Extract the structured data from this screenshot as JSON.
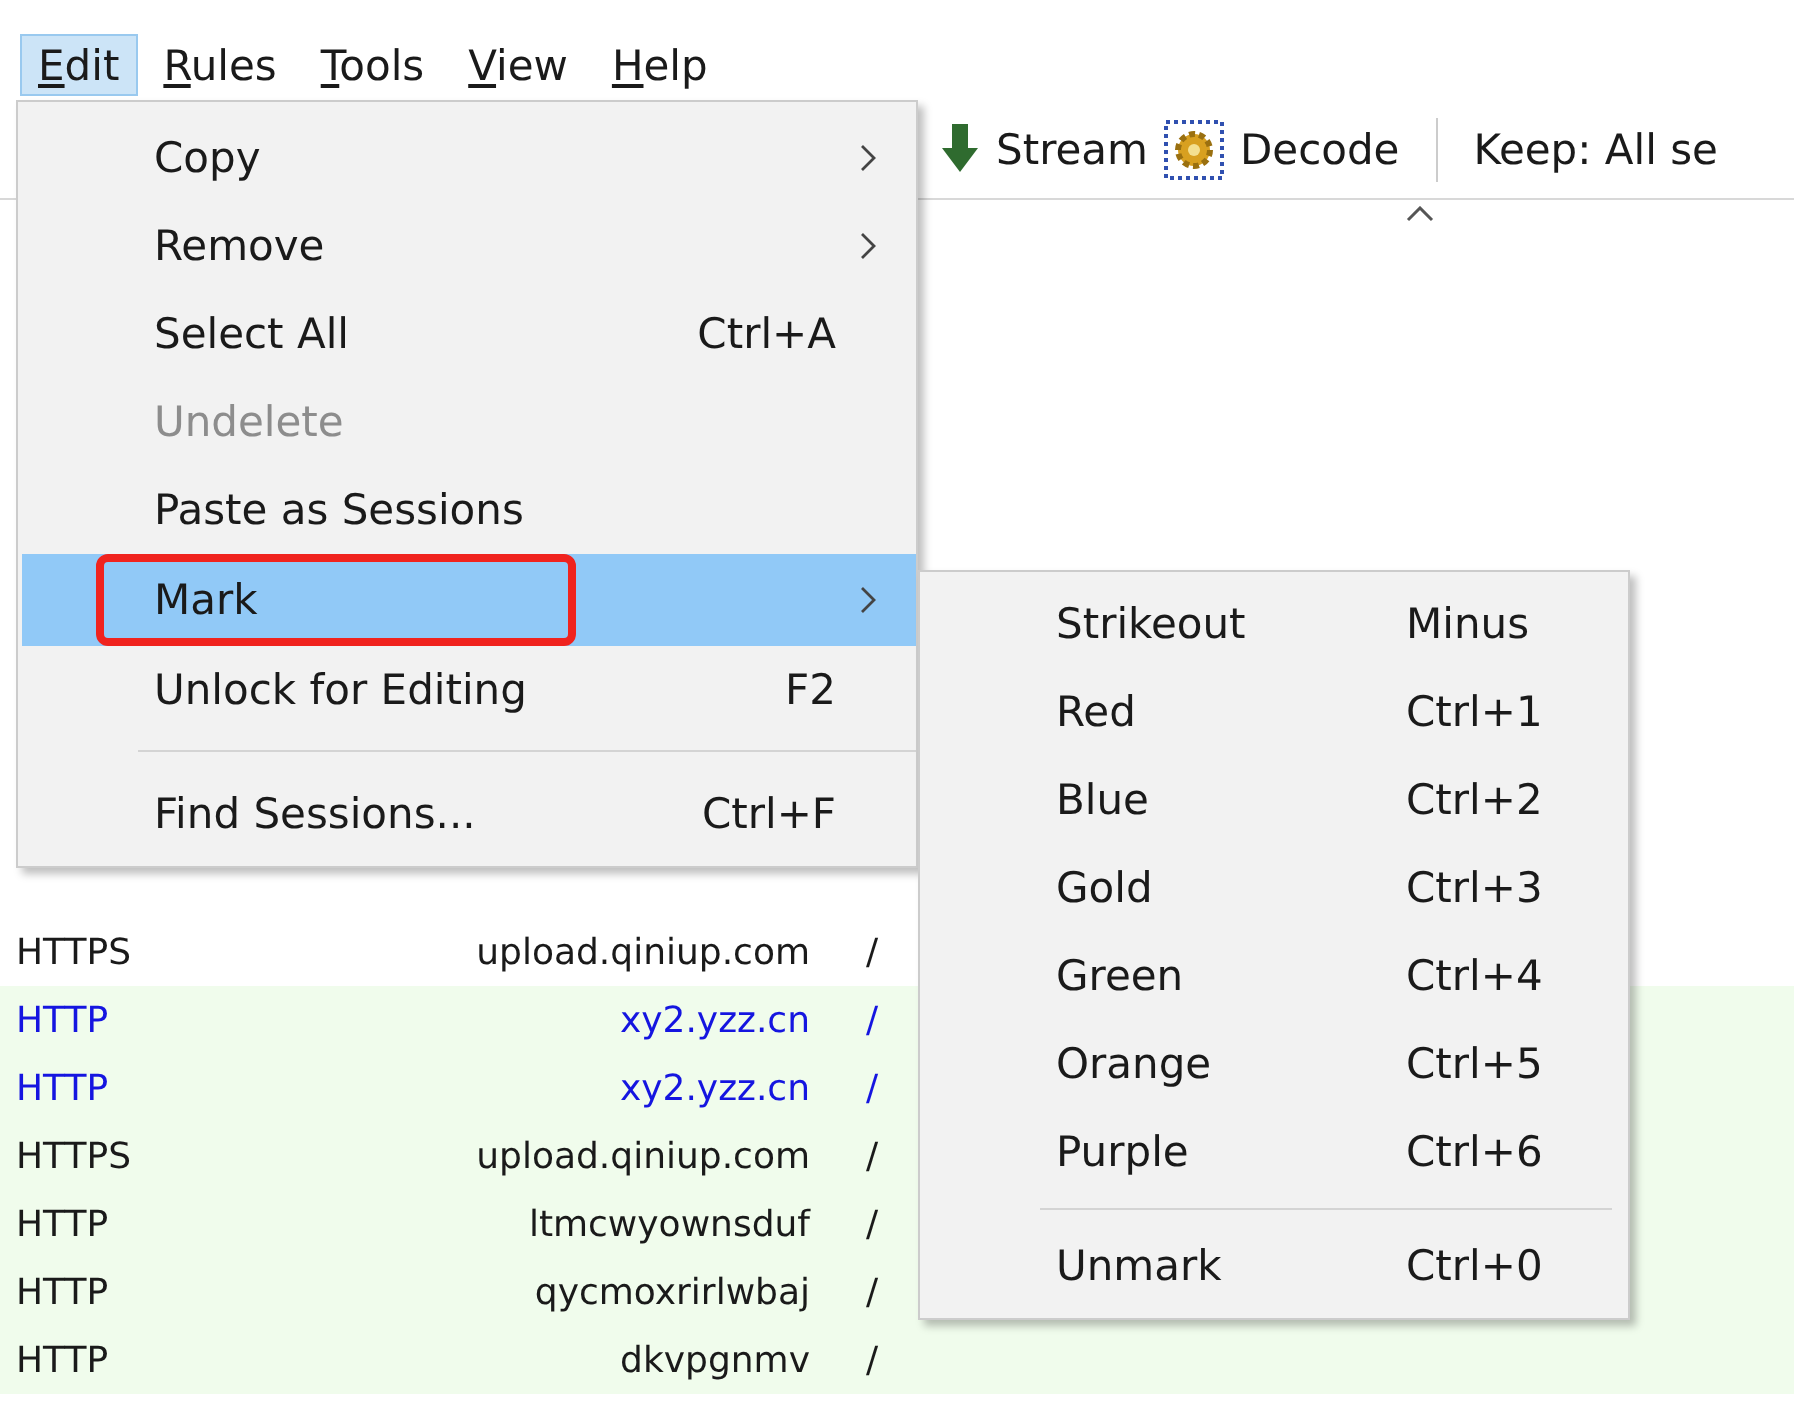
{
  "menubar": [
    {
      "label": "Edit",
      "selected": true
    },
    {
      "label": "Rules",
      "selected": false
    },
    {
      "label": "Tools",
      "selected": false
    },
    {
      "label": "View",
      "selected": false
    },
    {
      "label": "Help",
      "selected": false
    }
  ],
  "toolbar": [
    {
      "kind": "stream",
      "label": "Stream"
    },
    {
      "kind": "decode",
      "label": "Decode"
    },
    {
      "kind": "keep",
      "label": "Keep: All se"
    }
  ],
  "sessions": [
    {
      "protocol": "HTTPS",
      "host": "upload.qiniup.com",
      "url": "/",
      "tinted": false,
      "color": "#1a1a1a"
    },
    {
      "protocol": "HTTP",
      "host": "xy2.yzz.cn",
      "url": "/",
      "tinted": true,
      "color": "#1515e0"
    },
    {
      "protocol": "HTTP",
      "host": "xy2.yzz.cn",
      "url": "/",
      "tinted": true,
      "color": "#1515e0"
    },
    {
      "protocol": "HTTPS",
      "host": "upload.qiniup.com",
      "url": "/",
      "tinted": true,
      "color": "#1a1a1a"
    },
    {
      "protocol": "HTTP",
      "host": "ltmcwyownsduf",
      "url": "/",
      "tinted": true,
      "color": "#1a1a1a"
    },
    {
      "protocol": "HTTP",
      "host": "qycmoxrirlwbaj",
      "url": "/",
      "tinted": true,
      "color": "#1a1a1a"
    },
    {
      "protocol": "HTTP",
      "host": "dkvpgnmv",
      "url": "/",
      "tinted": true,
      "color": "#1a1a1a"
    }
  ],
  "edit_menu": [
    {
      "kind": "item",
      "label": "Copy",
      "submenu": true,
      "disabled": false,
      "selected": false,
      "annotated": false
    },
    {
      "kind": "item",
      "label": "Remove",
      "submenu": true,
      "disabled": false,
      "selected": false,
      "annotated": false
    },
    {
      "kind": "item",
      "label": "Select All",
      "shortcut": "Ctrl+A",
      "submenu": false,
      "disabled": false,
      "selected": false,
      "annotated": false
    },
    {
      "kind": "item",
      "label": "Undelete",
      "submenu": false,
      "disabled": true,
      "selected": false,
      "annotated": false
    },
    {
      "kind": "item",
      "label": "Paste as Sessions",
      "submenu": false,
      "disabled": false,
      "selected": false,
      "annotated": false
    },
    {
      "kind": "item",
      "label": "Mark",
      "submenu": true,
      "disabled": false,
      "selected": true,
      "annotated": true
    },
    {
      "kind": "item",
      "label": "Unlock for Editing",
      "shortcut": "F2",
      "submenu": false,
      "disabled": false,
      "selected": false,
      "annotated": false
    },
    {
      "kind": "separator"
    },
    {
      "kind": "item",
      "label": "Find Sessions...",
      "shortcut": "Ctrl+F",
      "submenu": false,
      "disabled": false,
      "selected": false,
      "annotated": false
    }
  ],
  "mark_submenu": [
    {
      "kind": "item",
      "label": "Strikeout",
      "shortcut": "Minus"
    },
    {
      "kind": "item",
      "label": "Red",
      "shortcut": "Ctrl+1"
    },
    {
      "kind": "item",
      "label": "Blue",
      "shortcut": "Ctrl+2"
    },
    {
      "kind": "item",
      "label": "Gold",
      "shortcut": "Ctrl+3"
    },
    {
      "kind": "item",
      "label": "Green",
      "shortcut": "Ctrl+4"
    },
    {
      "kind": "item",
      "label": "Orange",
      "shortcut": "Ctrl+5"
    },
    {
      "kind": "item",
      "label": "Purple",
      "shortcut": "Ctrl+6"
    },
    {
      "kind": "separator"
    },
    {
      "kind": "item",
      "label": "Unmark",
      "shortcut": "Ctrl+0"
    }
  ]
}
